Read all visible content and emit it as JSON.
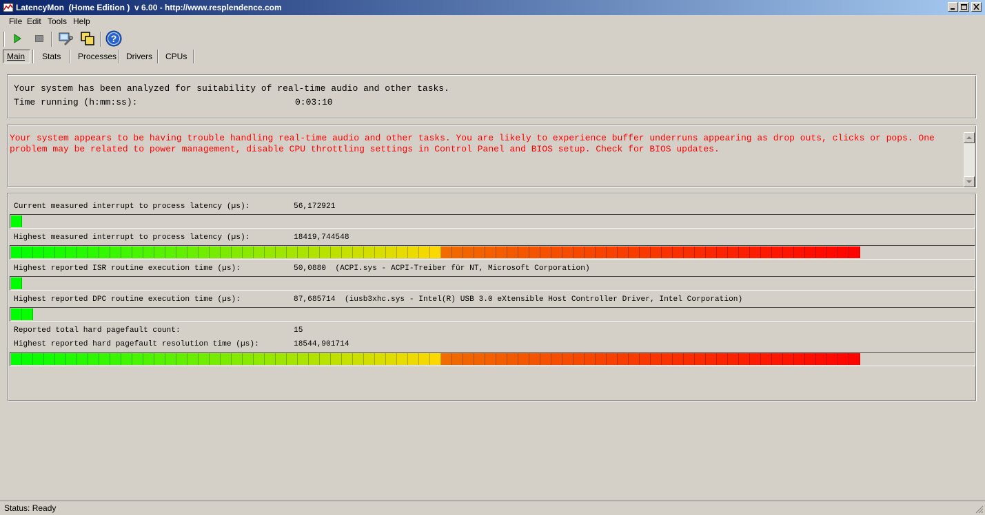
{
  "window": {
    "title": "LatencyMon  (Home Edition )  v 6.00 - http://www.resplendence.com",
    "minimize_icon": "minimize-icon",
    "maximize_icon": "maximize-icon",
    "close_icon": "close-icon"
  },
  "menu": {
    "items": [
      {
        "label": "File"
      },
      {
        "label": "Edit"
      },
      {
        "label": "Tools"
      },
      {
        "label": "Help"
      }
    ]
  },
  "toolbar": {
    "buttons": [
      "play-icon",
      "stop-icon",
      "wrench-icon",
      "windows-icon",
      "help-icon"
    ]
  },
  "tabs": [
    {
      "label": "Main"
    },
    {
      "label": "Stats"
    },
    {
      "label": "Processes"
    },
    {
      "label": "Drivers"
    },
    {
      "label": "CPUs"
    }
  ],
  "summary": {
    "analyzed_text": "Your system has been analyzed for suitability of real-time audio and other tasks.",
    "time_label": "Time running (h:mm:ss):",
    "time_value": "0:03:10"
  },
  "message": {
    "text": "Your system appears to be having trouble handling real-time audio and other tasks. You are likely to experience buffer underruns appearing as drop outs, clicks or pops. One problem may be related to power management, disable CPU throttling settings in Control Panel and BIOS setup. Check for BIOS updates.",
    "color": "#ff0000"
  },
  "metrics": {
    "current_latency": {
      "label": "Current measured interrupt to process latency (µs):",
      "value": "56,172921",
      "fill": 0.01
    },
    "highest_latency": {
      "label": "Highest measured interrupt to process latency (µs):",
      "value": "18419,744548",
      "fill": 0.89
    },
    "isr": {
      "label": "Highest reported ISR routine execution time (µs):",
      "value": "50,0880  (ACPI.sys - ACPI-Treiber für NT, Microsoft Corporation)",
      "fill": 0.01
    },
    "dpc": {
      "label": "Highest reported DPC routine execution time (µs):",
      "value": "87,685714  (iusb3xhc.sys - Intel(R) USB 3.0 eXtensible Host Controller Driver, Intel Corporation)",
      "fill": 0.022
    },
    "pagefault_count": {
      "label": "Reported total hard pagefault count:",
      "value": "15"
    },
    "pagefault_time": {
      "label": "Highest reported hard pagefault resolution time (µs):",
      "value": "18544,901714",
      "fill": 0.89
    }
  },
  "status": {
    "text": "Status: Ready"
  }
}
